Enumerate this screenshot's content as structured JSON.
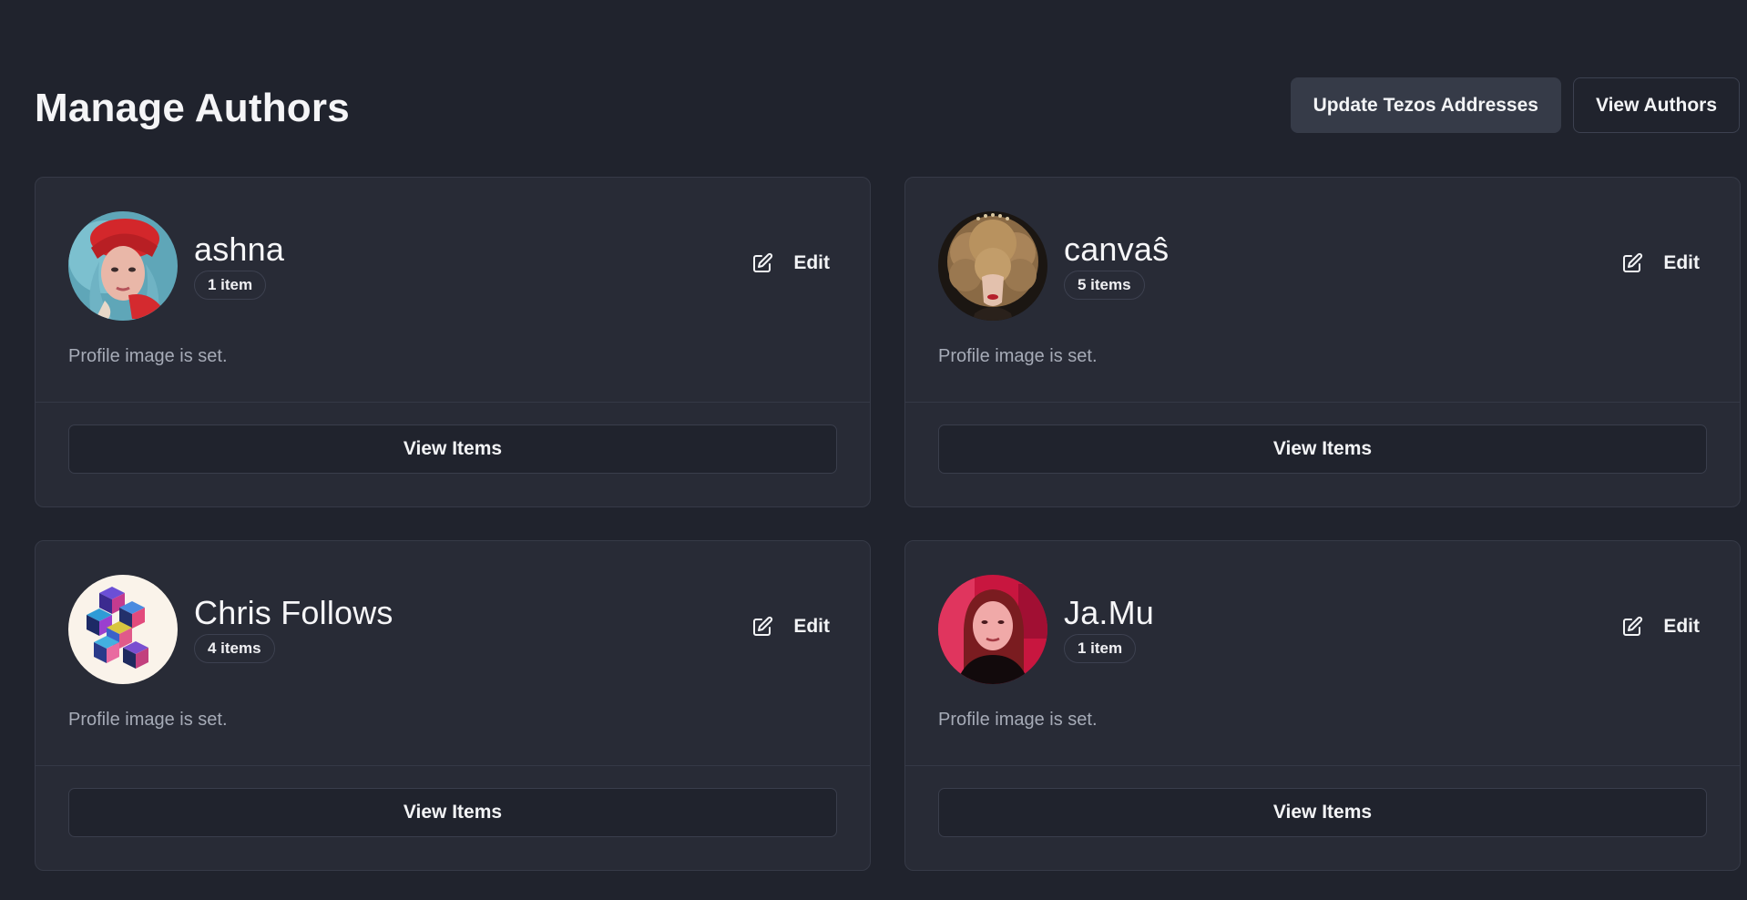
{
  "header": {
    "title": "Manage Authors",
    "update_tezos_label": "Update Tezos Addresses",
    "view_authors_label": "View Authors"
  },
  "authors": [
    {
      "name": "ashna",
      "count": "1 item",
      "edit_label": "Edit",
      "status": "Profile image is set.",
      "view_items_label": "View Items"
    },
    {
      "name": "canvaŝ",
      "count": "5 items",
      "edit_label": "Edit",
      "status": "Profile image is set.",
      "view_items_label": "View Items"
    },
    {
      "name": "Chris Follows",
      "count": "4 items",
      "edit_label": "Edit",
      "status": "Profile image is set.",
      "view_items_label": "View Items"
    },
    {
      "name": "Ja.Mu",
      "count": "1 item",
      "edit_label": "Edit",
      "status": "Profile image is set.",
      "view_items_label": "View Items"
    }
  ],
  "icons": {
    "edit": "pencil-square-icon"
  },
  "colors": {
    "background": "#20232d",
    "card": "#282b36",
    "border": "#363a47",
    "muted_text": "#a6abb7"
  }
}
